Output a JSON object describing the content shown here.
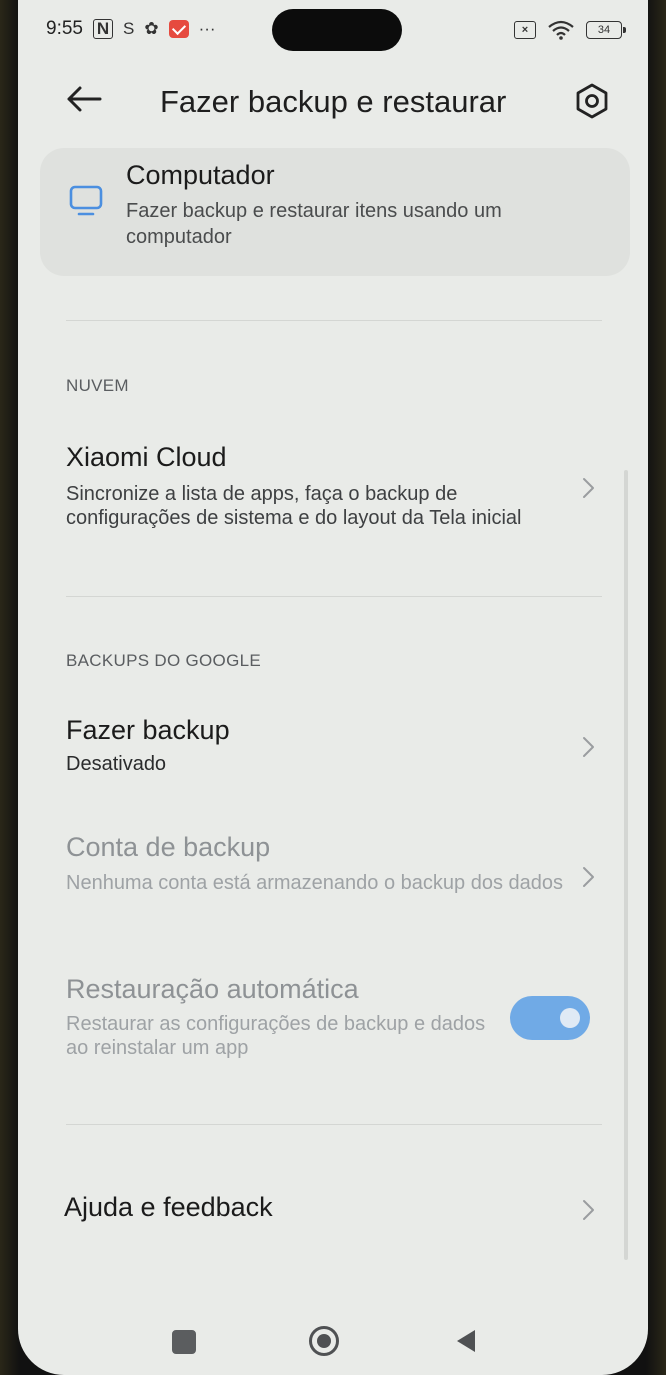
{
  "status_bar": {
    "time": "9:55",
    "nfc_icon": "nfc-icon",
    "sync_icon": "s-icon",
    "settings_icon": "gear-icon",
    "mail_icon": "mail-icon",
    "more": "···",
    "sim_icon_label": "×",
    "battery": "34"
  },
  "header": {
    "title": "Fazer backup e restaurar",
    "back_icon": "back-arrow-icon",
    "settings_icon": "settings-hexagon-icon"
  },
  "computer_card": {
    "title": "Computador",
    "subtitle": "Fazer backup e restaurar itens usando um computador",
    "icon": "monitor-icon"
  },
  "cloud_section": {
    "label": "NUVEM",
    "item": {
      "title": "Xiaomi Cloud",
      "subtitle": "Sincronize a lista de apps, faça o backup de configurações de sistema e do layout da Tela inicial"
    }
  },
  "google_section": {
    "label": "BACKUPS DO GOOGLE",
    "items": [
      {
        "title": "Fazer backup",
        "subtitle": "Desativado"
      },
      {
        "title": "Conta de backup",
        "subtitle": "Nenhuma conta está armazenando o backup dos dados"
      },
      {
        "title": "Restauração automática",
        "subtitle": "Restaurar as configurações de backup e dados ao reinstalar um app",
        "toggle_on": true
      }
    ]
  },
  "help": {
    "title": "Ajuda e feedback"
  },
  "colors": {
    "background": "#e9ebe8",
    "card": "#dfe1de",
    "toggle_accent": "#5c9fe6",
    "mail_red": "#e64a3f"
  }
}
